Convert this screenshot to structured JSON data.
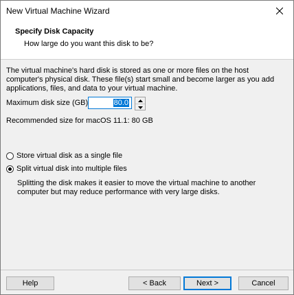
{
  "window": {
    "title": "New Virtual Machine Wizard"
  },
  "header": {
    "title": "Specify Disk Capacity",
    "subtitle": "How large do you want this disk to be?"
  },
  "content": {
    "description": "The virtual machine's hard disk is stored as one or more files on the host computer's physical disk. These file(s) start small and become larger as you add applications, files, and data to your virtual machine.",
    "size_label": "Maximum disk size (GB):",
    "size_value": "80.0",
    "recommended": "Recommended size for macOS 11.1: 80 GB"
  },
  "options": {
    "single_label": "Store virtual disk as a single file",
    "split_label": "Split virtual disk into multiple files",
    "selected": "split",
    "split_description": "Splitting the disk makes it easier to move the virtual machine to another computer but may reduce performance with very large disks."
  },
  "buttons": {
    "help": "Help",
    "back": "< Back",
    "next": "Next >",
    "cancel": "Cancel"
  },
  "colors": {
    "accent": "#0078d7",
    "dialog_bg": "#f0f0f0"
  },
  "icons": [
    "close-icon",
    "spin-up-icon",
    "spin-down-icon"
  ]
}
